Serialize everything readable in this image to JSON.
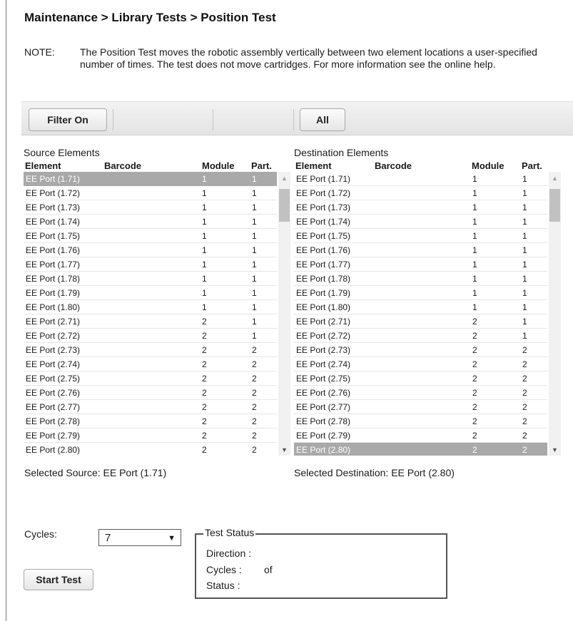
{
  "breadcrumb": "Maintenance > Library Tests > Position Test",
  "note": {
    "label": "NOTE:",
    "text": "The Position Test moves the robotic assembly vertically between two element locations a user-specified number of times. The test does not move cartridges. For more information see the online help."
  },
  "toolbar": {
    "filter_label": "Filter On",
    "all_label": "All"
  },
  "source": {
    "title": "Source Elements",
    "columns": [
      "Element",
      "Barcode",
      "Module",
      "Part."
    ],
    "selected_index": 0,
    "rows": [
      [
        "EE Port (1.71)",
        "",
        "1",
        "1"
      ],
      [
        "EE Port (1.72)",
        "",
        "1",
        "1"
      ],
      [
        "EE Port (1.73)",
        "",
        "1",
        "1"
      ],
      [
        "EE Port (1.74)",
        "",
        "1",
        "1"
      ],
      [
        "EE Port (1.75)",
        "",
        "1",
        "1"
      ],
      [
        "EE Port (1.76)",
        "",
        "1",
        "1"
      ],
      [
        "EE Port (1.77)",
        "",
        "1",
        "1"
      ],
      [
        "EE Port (1.78)",
        "",
        "1",
        "1"
      ],
      [
        "EE Port (1.79)",
        "",
        "1",
        "1"
      ],
      [
        "EE Port (1.80)",
        "",
        "1",
        "1"
      ],
      [
        "EE Port (2.71)",
        "",
        "2",
        "1"
      ],
      [
        "EE Port (2.72)",
        "",
        "2",
        "1"
      ],
      [
        "EE Port (2.73)",
        "",
        "2",
        "2"
      ],
      [
        "EE Port (2.74)",
        "",
        "2",
        "2"
      ],
      [
        "EE Port (2.75)",
        "",
        "2",
        "2"
      ],
      [
        "EE Port (2.76)",
        "",
        "2",
        "2"
      ],
      [
        "EE Port (2.77)",
        "",
        "2",
        "2"
      ],
      [
        "EE Port (2.78)",
        "",
        "2",
        "2"
      ],
      [
        "EE Port (2.79)",
        "",
        "2",
        "2"
      ],
      [
        "EE Port (2.80)",
        "",
        "2",
        "2"
      ]
    ]
  },
  "destination": {
    "title": "Destination Elements",
    "columns": [
      "Element",
      "Barcode",
      "Module",
      "Part."
    ],
    "selected_index": 19,
    "rows": [
      [
        "EE Port (1.71)",
        "",
        "1",
        "1"
      ],
      [
        "EE Port (1.72)",
        "",
        "1",
        "1"
      ],
      [
        "EE Port (1.73)",
        "",
        "1",
        "1"
      ],
      [
        "EE Port (1.74)",
        "",
        "1",
        "1"
      ],
      [
        "EE Port (1.75)",
        "",
        "1",
        "1"
      ],
      [
        "EE Port (1.76)",
        "",
        "1",
        "1"
      ],
      [
        "EE Port (1.77)",
        "",
        "1",
        "1"
      ],
      [
        "EE Port (1.78)",
        "",
        "1",
        "1"
      ],
      [
        "EE Port (1.79)",
        "",
        "1",
        "1"
      ],
      [
        "EE Port (1.80)",
        "",
        "1",
        "1"
      ],
      [
        "EE Port (2.71)",
        "",
        "2",
        "1"
      ],
      [
        "EE Port (2.72)",
        "",
        "2",
        "1"
      ],
      [
        "EE Port (2.73)",
        "",
        "2",
        "2"
      ],
      [
        "EE Port (2.74)",
        "",
        "2",
        "2"
      ],
      [
        "EE Port (2.75)",
        "",
        "2",
        "2"
      ],
      [
        "EE Port (2.76)",
        "",
        "2",
        "2"
      ],
      [
        "EE Port (2.77)",
        "",
        "2",
        "2"
      ],
      [
        "EE Port (2.78)",
        "",
        "2",
        "2"
      ],
      [
        "EE Port (2.79)",
        "",
        "2",
        "2"
      ],
      [
        "EE Port (2.80)",
        "",
        "2",
        "2"
      ]
    ]
  },
  "selected_source": "Selected Source: EE Port (1.71)",
  "selected_destination": "Selected Destination: EE Port (2.80)",
  "cycles": {
    "label": "Cycles:",
    "value": "7",
    "arrow_glyph": "▼"
  },
  "start_label": "Start Test",
  "status": {
    "legend": "Test Status",
    "direction_label": "Direction :",
    "cycles_label": "Cycles :",
    "cycles_of": "of",
    "status_label": "Status :"
  },
  "icons": {
    "scroll_up": "▲",
    "scroll_down": "▼"
  },
  "colors": {
    "selected_row_bg": "#a9a9a9",
    "toolbar_bg": "#e9e9e9"
  }
}
